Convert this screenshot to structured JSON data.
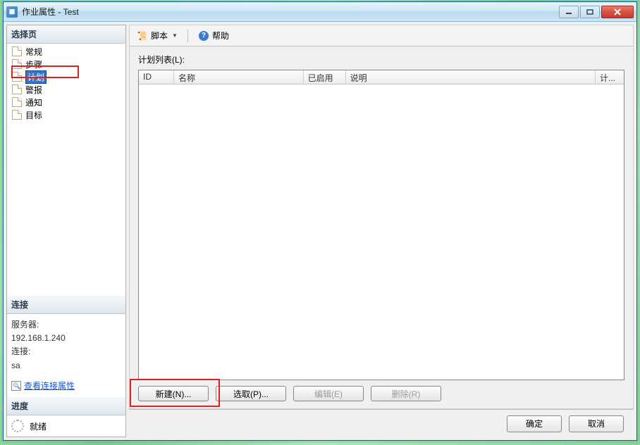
{
  "window": {
    "title": "作业属性 - Test"
  },
  "sidebar": {
    "header": "选择页",
    "items": [
      {
        "label": "常规"
      },
      {
        "label": "步骤"
      },
      {
        "label": "计划",
        "selected": true
      },
      {
        "label": "警报"
      },
      {
        "label": "通知"
      },
      {
        "label": "目标"
      }
    ]
  },
  "connection": {
    "header": "连接",
    "server_label": "服务器:",
    "server_value": "192.168.1.240",
    "conn_label": "连接:",
    "conn_value": "sa",
    "view_props": "查看连接属性"
  },
  "progress": {
    "header": "进度",
    "status": "就绪"
  },
  "toolbar": {
    "script": "脚本",
    "help": "帮助"
  },
  "list": {
    "label": "计划列表(L):",
    "columns": {
      "id": "ID",
      "name": "名称",
      "enabled": "已启用",
      "desc": "说明",
      "plan": "计..."
    }
  },
  "buttons": {
    "new": "新建(N)...",
    "pick": "选取(P)...",
    "edit": "编辑(E)",
    "delete": "删除(R)"
  },
  "footer": {
    "ok": "确定",
    "cancel": "取消"
  }
}
